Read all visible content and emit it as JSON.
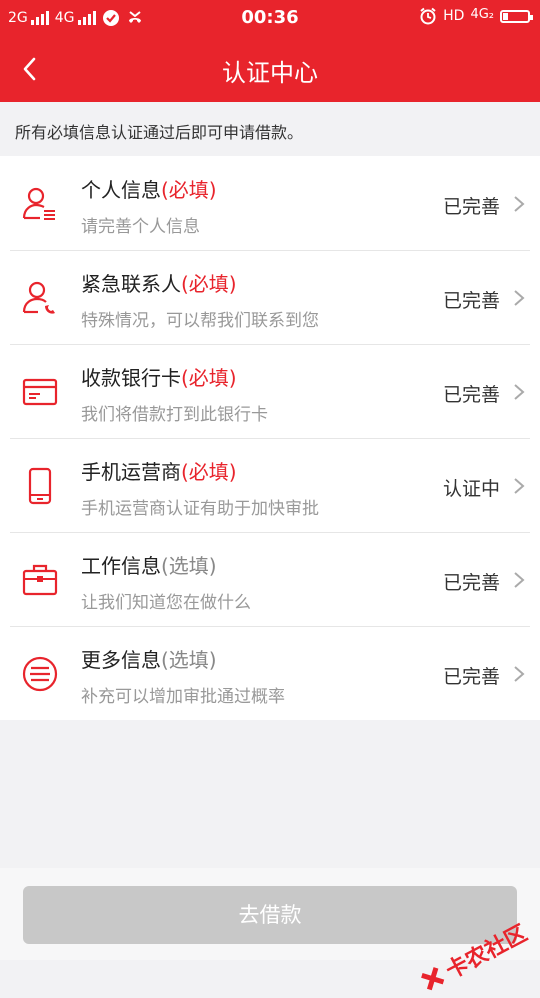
{
  "status_bar": {
    "net1": "2G",
    "net2": "4G",
    "time": "00:36",
    "hd": "HD",
    "net3": "4G₂",
    "battery_level": 0.2,
    "icons": [
      "signal-bars-icon",
      "check-circle-icon",
      "missed-call-icon",
      "alarm-clock-icon",
      "battery-icon"
    ]
  },
  "header": {
    "title": "认证中心",
    "back_icon": "chevron-left-icon"
  },
  "notice": "所有必填信息认证通过后即可申请借款。",
  "items": [
    {
      "title": "个人信息",
      "tag": "(必填)",
      "tag_type": "required",
      "subtitle": "请完善个人信息",
      "status": "已完善",
      "icon": "person-info-icon"
    },
    {
      "title": "紧急联系人",
      "tag": "(必填)",
      "tag_type": "required",
      "subtitle": "特殊情况，可以帮我们联系到您",
      "status": "已完善",
      "icon": "contact-phone-icon"
    },
    {
      "title": "收款银行卡",
      "tag": "(必填)",
      "tag_type": "required",
      "subtitle": "我们将借款打到此银行卡",
      "status": "已完善",
      "icon": "bank-card-icon"
    },
    {
      "title": "手机运营商",
      "tag": "(必填)",
      "tag_type": "required",
      "subtitle": "手机运营商认证有助于加快审批",
      "status": "认证中",
      "icon": "mobile-phone-icon"
    },
    {
      "title": "工作信息",
      "tag": "(选填)",
      "tag_type": "optional",
      "subtitle": "让我们知道您在做什么",
      "status": "已完善",
      "icon": "briefcase-icon"
    },
    {
      "title": "更多信息",
      "tag": "(选填)",
      "tag_type": "optional",
      "subtitle": "补充可以增加审批通过概率",
      "status": "已完善",
      "icon": "more-info-icon"
    }
  ],
  "loan_button": "去借款",
  "watermark": "卡农社区",
  "colors": {
    "accent": "#e8242c",
    "button_disabled": "#c8c8c8"
  }
}
